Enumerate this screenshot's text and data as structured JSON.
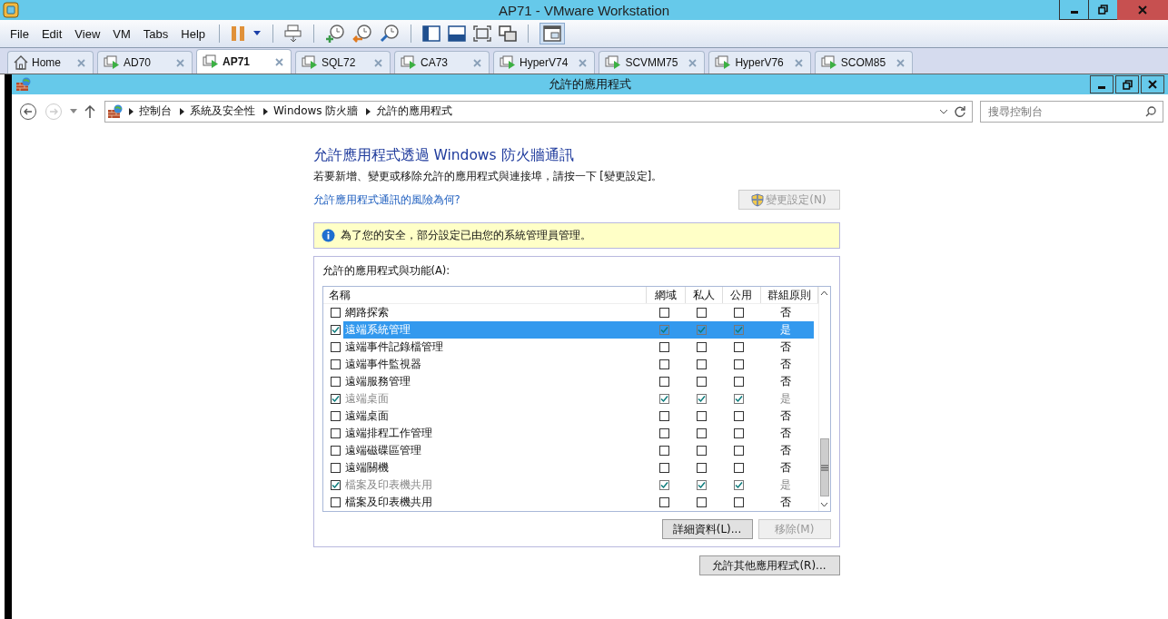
{
  "window": {
    "title": "AP71 - VMware Workstation"
  },
  "menu": [
    "File",
    "Edit",
    "View",
    "VM",
    "Tabs",
    "Help"
  ],
  "tabs": [
    {
      "label": "Home",
      "kind": "home",
      "selected": false
    },
    {
      "label": "AD70",
      "kind": "vm",
      "selected": false
    },
    {
      "label": "AP71",
      "kind": "vm",
      "selected": true
    },
    {
      "label": "SQL72",
      "kind": "vm",
      "selected": false
    },
    {
      "label": "CA73",
      "kind": "vm",
      "selected": false
    },
    {
      "label": "HyperV74",
      "kind": "vm",
      "selected": false
    },
    {
      "label": "SCVMM75",
      "kind": "vm",
      "selected": false
    },
    {
      "label": "HyperV76",
      "kind": "vm",
      "selected": false
    },
    {
      "label": "SCOM85",
      "kind": "vm",
      "selected": false
    }
  ],
  "guest_window": {
    "title": "允許的應用程式"
  },
  "breadcrumb": [
    "控制台",
    "系統及安全性",
    "Windows 防火牆",
    "允許的應用程式"
  ],
  "search": {
    "placeholder": "搜尋控制台"
  },
  "heading": "允許應用程式透過 Windows 防火牆通訊",
  "instruction": "若要新增、變更或移除允許的應用程式與連接埠，請按一下 [變更設定]。",
  "risk_link": "允許應用程式通訊的風險為何?",
  "change_settings_button": {
    "label": "變更設定(N)",
    "disabled": true
  },
  "notice": "為了您的安全，部分設定已由您的系統管理員管理。",
  "list": {
    "label": "允許的應用程式與功能(A):",
    "columns": [
      "名稱",
      "網域",
      "私人",
      "公用",
      "群組原則"
    ],
    "rows": [
      {
        "name": "網路探索",
        "checked": false,
        "domain": false,
        "private": false,
        "public": false,
        "group_policy": "否",
        "disabled": false,
        "selected": false
      },
      {
        "name": "遠端系統管理",
        "checked": true,
        "domain": true,
        "private": true,
        "public": true,
        "group_policy": "是",
        "disabled": true,
        "selected": true
      },
      {
        "name": "遠端事件記錄檔管理",
        "checked": false,
        "domain": false,
        "private": false,
        "public": false,
        "group_policy": "否",
        "disabled": false,
        "selected": false
      },
      {
        "name": "遠端事件監視器",
        "checked": false,
        "domain": false,
        "private": false,
        "public": false,
        "group_policy": "否",
        "disabled": false,
        "selected": false
      },
      {
        "name": "遠端服務管理",
        "checked": false,
        "domain": false,
        "private": false,
        "public": false,
        "group_policy": "否",
        "disabled": false,
        "selected": false
      },
      {
        "name": "遠端桌面",
        "checked": true,
        "domain": true,
        "private": true,
        "public": true,
        "group_policy": "是",
        "disabled": true,
        "selected": false
      },
      {
        "name": "遠端桌面",
        "checked": false,
        "domain": false,
        "private": false,
        "public": false,
        "group_policy": "否",
        "disabled": false,
        "selected": false
      },
      {
        "name": "遠端排程工作管理",
        "checked": false,
        "domain": false,
        "private": false,
        "public": false,
        "group_policy": "否",
        "disabled": false,
        "selected": false
      },
      {
        "name": "遠端磁碟區管理",
        "checked": false,
        "domain": false,
        "private": false,
        "public": false,
        "group_policy": "否",
        "disabled": false,
        "selected": false
      },
      {
        "name": "遠端關機",
        "checked": false,
        "domain": false,
        "private": false,
        "public": false,
        "group_policy": "否",
        "disabled": false,
        "selected": false
      },
      {
        "name": "檔案及印表機共用",
        "checked": true,
        "domain": true,
        "private": true,
        "public": true,
        "group_policy": "是",
        "disabled": true,
        "selected": false
      },
      {
        "name": "檔案及印表機共用",
        "checked": false,
        "domain": false,
        "private": false,
        "public": false,
        "group_policy": "否",
        "disabled": false,
        "selected": false
      }
    ],
    "details_button": {
      "label": "詳細資料(L)...",
      "disabled": false
    },
    "remove_button": {
      "label": "移除(M)",
      "disabled": true
    }
  },
  "allow_other_button": {
    "label": "允許其他應用程式(R)...",
    "disabled": false
  }
}
